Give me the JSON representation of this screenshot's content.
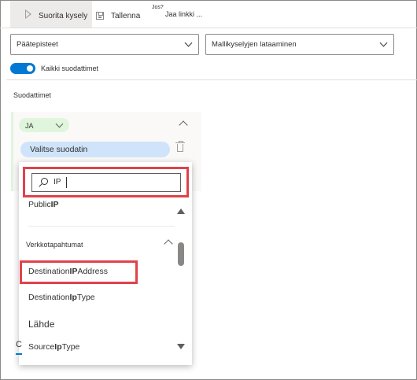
{
  "toolbar": {
    "run_label": "Suorita kysely",
    "save_label": "Tallenna",
    "share_prefix": "Jos?",
    "share_label": "Jaa linkki ..."
  },
  "dropdowns": {
    "endpoints": "Päätepisteet",
    "sample_queries": "Mallikyselyjen lataaminen"
  },
  "toggle": {
    "label": "Kaikki suodattimet",
    "on": true
  },
  "filters": {
    "title": "Suodattimet",
    "operator": "JA",
    "select_filter": "Valitse suodatin"
  },
  "search": {
    "value": "IP"
  },
  "results": {
    "partial_item": {
      "prefix": "Public",
      "match": "IP",
      "suffix": ""
    },
    "group_network": "Verkkotapahtumat",
    "items": [
      {
        "prefix": "Destination",
        "match": "IP",
        "suffix": "Address"
      },
      {
        "prefix": "Destination",
        "match": "Ip",
        "suffix": "Type"
      }
    ],
    "group_source": "Lähde",
    "source_item": {
      "prefix": "Source",
      "match": "Ip",
      "suffix": "Type"
    }
  },
  "bottom_peek": "C",
  "colors": {
    "accent": "#0078d4",
    "highlight": "#e0424b",
    "and_pill": "#dff6dd",
    "filter_pill": "#cfe4fa"
  }
}
